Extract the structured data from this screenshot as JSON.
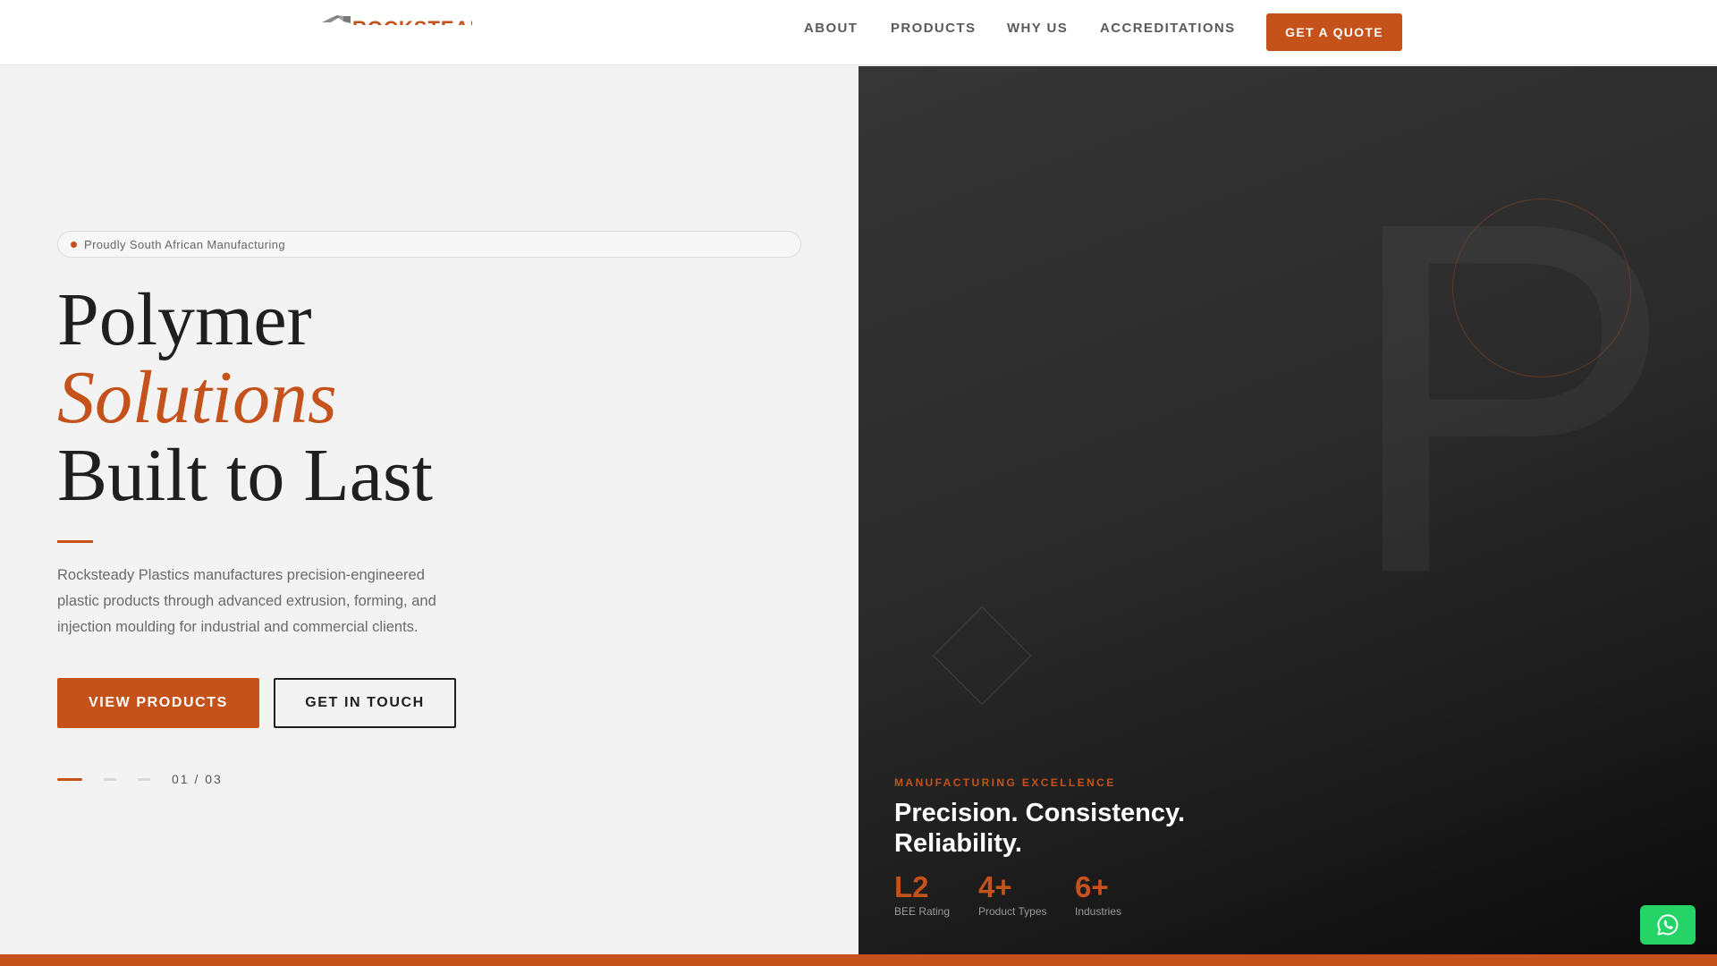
{
  "brand": {
    "logo_text": "ROCKSTEADY",
    "accent_color": "#c4521a"
  },
  "nav": {
    "links": [
      {
        "label": "ABOUT"
      },
      {
        "label": "PRODUCTS"
      },
      {
        "label": "WHY US"
      },
      {
        "label": "ACCREDITATIONS"
      }
    ],
    "cta_label": "GET A QUOTE"
  },
  "hero": {
    "badge": "Proudly South African Manufacturing",
    "headline_line1": "Polymer",
    "headline_line2": "Solutions",
    "headline_line3": "Built to Last",
    "description": "Rocksteady Plastics manufactures precision-engineered plastic products through advanced extrusion, forming, and injection moulding for industrial and commercial clients.",
    "primary_button": "VIEW PRODUCTS",
    "secondary_button": "GET IN TOUCH",
    "slide_counter": "01 / 03",
    "active_slide": 1,
    "total_slides": 3
  },
  "feature": {
    "background_letter": "P",
    "eyebrow": "MANUFACTURING EXCELLENCE",
    "tagline": "Precision. Consistency. Reliability.",
    "stats": [
      {
        "value": "L2",
        "label": "BEE Rating"
      },
      {
        "value": "4+",
        "label": "Product Types"
      },
      {
        "value": "6+",
        "label": "Industries"
      }
    ]
  },
  "whatsapp": {
    "icon": "whatsapp-icon",
    "color": "#25d366"
  }
}
